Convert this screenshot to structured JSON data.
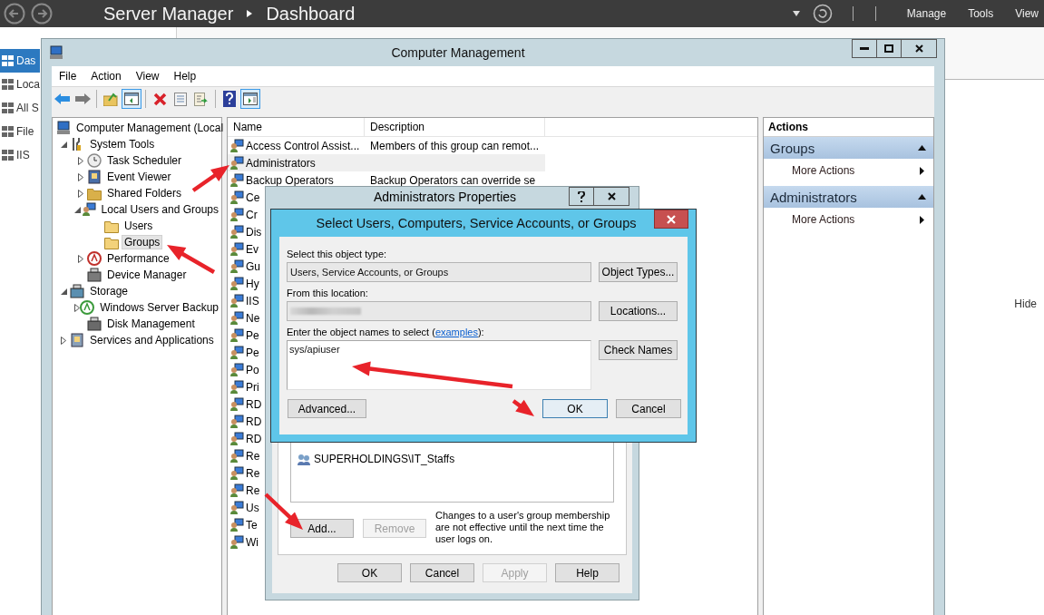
{
  "server_manager": {
    "title": "Server Manager",
    "breadcrumb": "Dashboard",
    "menu": [
      "Manage",
      "Tools",
      "View"
    ],
    "nav": [
      {
        "label": "Das",
        "selected": true
      },
      {
        "label": "Loca",
        "selected": false
      },
      {
        "label": "All S",
        "selected": false
      },
      {
        "label": "File",
        "selected": false
      },
      {
        "label": "IIS",
        "selected": false
      }
    ],
    "hide_link": "Hide"
  },
  "computer_management": {
    "title": "Computer Management",
    "menu": [
      "File",
      "Action",
      "View",
      "Help"
    ],
    "toolbar": [
      {
        "kind": "back",
        "pressed": false
      },
      {
        "kind": "forward",
        "pressed": false
      },
      {
        "kind": "separator"
      },
      {
        "kind": "up",
        "pressed": false
      },
      {
        "kind": "tree",
        "pressed": true
      },
      {
        "kind": "separator"
      },
      {
        "kind": "delete",
        "pressed": false
      },
      {
        "kind": "properties",
        "pressed": false
      },
      {
        "kind": "export",
        "pressed": false
      },
      {
        "kind": "separator"
      },
      {
        "kind": "help",
        "pressed": false
      },
      {
        "kind": "pane",
        "pressed": true
      }
    ],
    "tree": {
      "label": "Computer Management (Local",
      "kind": "computer",
      "selected": false,
      "children": [
        {
          "label": "System Tools",
          "kind": "tools",
          "expanded": true,
          "selected": false,
          "children": [
            {
              "label": "Task Scheduler",
              "kind": "clock",
              "expanded": false,
              "selected": false
            },
            {
              "label": "Event Viewer",
              "kind": "log",
              "expanded": false,
              "selected": false
            },
            {
              "label": "Shared Folders",
              "kind": "share",
              "expanded": false,
              "selected": false
            },
            {
              "label": "Local Users and Groups",
              "kind": "users",
              "expanded": true,
              "selected": false,
              "children": [
                {
                  "label": "Users",
                  "kind": "folder",
                  "selected": false
                },
                {
                  "label": "Groups",
                  "kind": "folder",
                  "selected": true
                }
              ]
            },
            {
              "label": "Performance",
              "kind": "performance",
              "expanded": false,
              "selected": false
            },
            {
              "label": "Device Manager",
              "kind": "device",
              "selected": false
            }
          ]
        },
        {
          "label": "Storage",
          "kind": "storage",
          "expanded": true,
          "selected": false,
          "children": [
            {
              "label": "Windows Server Backup",
              "kind": "backup",
              "expanded": false,
              "selected": false
            },
            {
              "label": "Disk Management",
              "kind": "disk",
              "selected": false
            }
          ]
        },
        {
          "label": "Services and Applications",
          "kind": "services",
          "expanded": false,
          "selected": false
        }
      ]
    },
    "list": {
      "columns": [
        "Name",
        "Description"
      ],
      "rows": [
        {
          "name": "Access Control Assist...",
          "description": "Members of this group can remot...",
          "selected": false
        },
        {
          "name": "Administrators",
          "selected": true
        },
        {
          "name": "Backup Operators",
          "description": "Backup Operators can override se",
          "selected": false
        },
        {
          "name": "Ce",
          "selected": false
        },
        {
          "name": "Cr",
          "selected": false
        },
        {
          "name": "Dis",
          "selected": false
        },
        {
          "name": "Ev",
          "selected": false
        },
        {
          "name": "Gu",
          "selected": false
        },
        {
          "name": "Hy",
          "selected": false
        },
        {
          "name": "IIS",
          "selected": false
        },
        {
          "name": "Ne",
          "selected": false
        },
        {
          "name": "Pe",
          "selected": false
        },
        {
          "name": "Pe",
          "selected": false
        },
        {
          "name": "Po",
          "selected": false
        },
        {
          "name": "Pri",
          "selected": false
        },
        {
          "name": "RD",
          "selected": false
        },
        {
          "name": "RD",
          "selected": false
        },
        {
          "name": "RD",
          "selected": false
        },
        {
          "name": "Re",
          "selected": false
        },
        {
          "name": "Re",
          "selected": false
        },
        {
          "name": "Re",
          "selected": false
        },
        {
          "name": "Us",
          "selected": false
        },
        {
          "name": "Te",
          "selected": false
        },
        {
          "name": "Wi",
          "selected": false
        }
      ]
    },
    "actions": {
      "title": "Actions",
      "sections": [
        {
          "title": "Groups",
          "expanded": true,
          "items": [
            "More Actions"
          ]
        },
        {
          "title": "Administrators",
          "expanded": true,
          "items": [
            "More Actions"
          ]
        }
      ]
    }
  },
  "properties_dialog": {
    "title": "Administrators Properties",
    "members": [
      "SUPERHOLDINGS\\IT_Staffs"
    ],
    "member_buttons": [
      {
        "label": "Add...",
        "disabled": false
      },
      {
        "label": "Remove",
        "disabled": true
      }
    ],
    "note": "Changes to a user's group membership are not effective until the next time the user logs on.",
    "buttons": [
      {
        "label": "OK",
        "disabled": false
      },
      {
        "label": "Cancel",
        "disabled": false
      },
      {
        "label": "Apply",
        "disabled": true
      },
      {
        "label": "Help",
        "disabled": false
      }
    ]
  },
  "select_dialog": {
    "title": "Select Users, Computers, Service Accounts, or Groups",
    "object_type_label": "Select this object type:",
    "object_type": "Users, Service Accounts, or Groups",
    "object_types_button": "Object Types...",
    "location_label": "From this location:",
    "location_button": "Locations...",
    "names_label_before": "Enter the object names to select (",
    "names_link": "examples",
    "names_label_after": "):",
    "names_value": "sys/apiuser",
    "check_names_button": "Check Names",
    "advanced_button": "Advanced...",
    "ok_button": "OK",
    "cancel_button": "Cancel"
  }
}
